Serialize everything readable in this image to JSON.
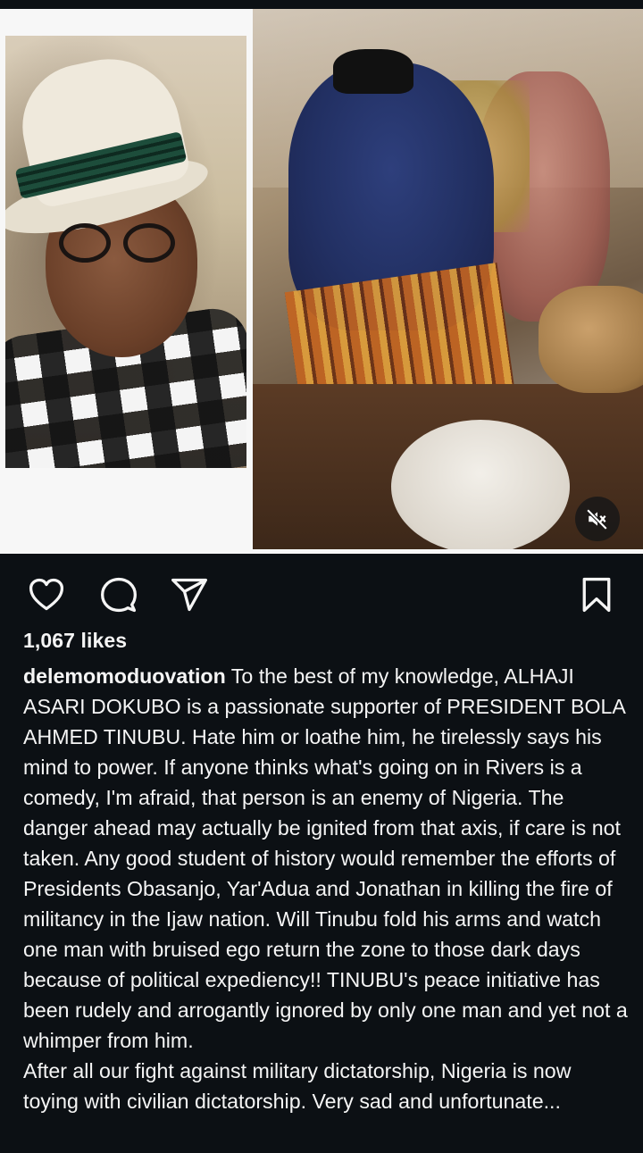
{
  "post": {
    "likes": "1,067 likes",
    "username": "delemomoduovation",
    "caption_text": " To the best of my knowledge, ALHAJI ASARI DOKUBO is a passionate supporter of PRESIDENT BOLA AHMED TINUBU. Hate him or loathe him, he tirelessly says his mind to power. If anyone thinks what's going on in Rivers is a comedy, I'm afraid, that person is an enemy of Nigeria. The danger ahead may actually be ignited from that axis, if care is not taken. Any good student of history would remember the efforts of Presidents Obasanjo, Yar'Adua and Jonathan in killing the fire of militancy in the Ijaw nation. Will Tinubu fold his arms and watch one man with bruised ego return the zone to those dark days because of political expediency!! TINUBU's peace initiative has been rudely and arrogantly ignored by only one man and yet not a whimper from him.\nAfter all our fight against military dictatorship, Nigeria is now toying with civilian dictatorship. Very sad and unfortunate..."
  },
  "icons": {
    "like": "heart-icon",
    "comment": "comment-bubble-icon",
    "share": "send-icon",
    "save": "bookmark-icon",
    "mute": "speaker-muted-icon"
  },
  "colors": {
    "background": "#0c1014",
    "text": "#f5f5f5"
  }
}
